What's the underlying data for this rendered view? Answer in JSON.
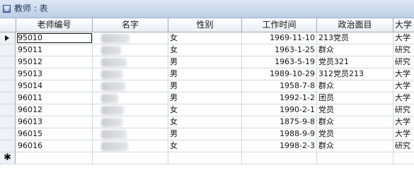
{
  "window": {
    "title": "教师 : 表"
  },
  "columns": [
    "老师编号",
    "名字",
    "性别",
    "工作时间",
    "政治面目",
    "大学"
  ],
  "rows": [
    {
      "id": "95010",
      "gender": "女",
      "work_date": "1969-11-10",
      "politics": "213党员",
      "edu": "大学"
    },
    {
      "id": "95011",
      "gender": "女",
      "work_date": "1963-1-25",
      "politics": "群众",
      "edu": "研究"
    },
    {
      "id": "95012",
      "gender": "男",
      "work_date": "1963-5-19",
      "politics": "党员321",
      "edu": "研究"
    },
    {
      "id": "95013",
      "gender": "男",
      "work_date": "1989-10-29",
      "politics": "312党员213",
      "edu": "大学"
    },
    {
      "id": "95014",
      "gender": "男",
      "work_date": "1958-7-8",
      "politics": "群众",
      "edu": "大学"
    },
    {
      "id": "96011",
      "gender": "男",
      "work_date": "1992-1-2",
      "politics": "团员",
      "edu": "大学"
    },
    {
      "id": "96012",
      "gender": "女",
      "work_date": "1990-2-1",
      "politics": "党员",
      "edu": "研究"
    },
    {
      "id": "96013",
      "gender": "女",
      "work_date": "1875-9-8",
      "politics": "群众",
      "edu": "大学"
    },
    {
      "id": "96015",
      "gender": "男",
      "work_date": "1988-9-9",
      "politics": "党员",
      "edu": "大学"
    },
    {
      "id": "96016",
      "gender": "女",
      "work_date": "1998-2-3",
      "politics": "群众",
      "edu": "研究"
    }
  ],
  "new_row_marker": "✱",
  "current_row_marker": "arrow-icon",
  "name_column_state": "blurred"
}
